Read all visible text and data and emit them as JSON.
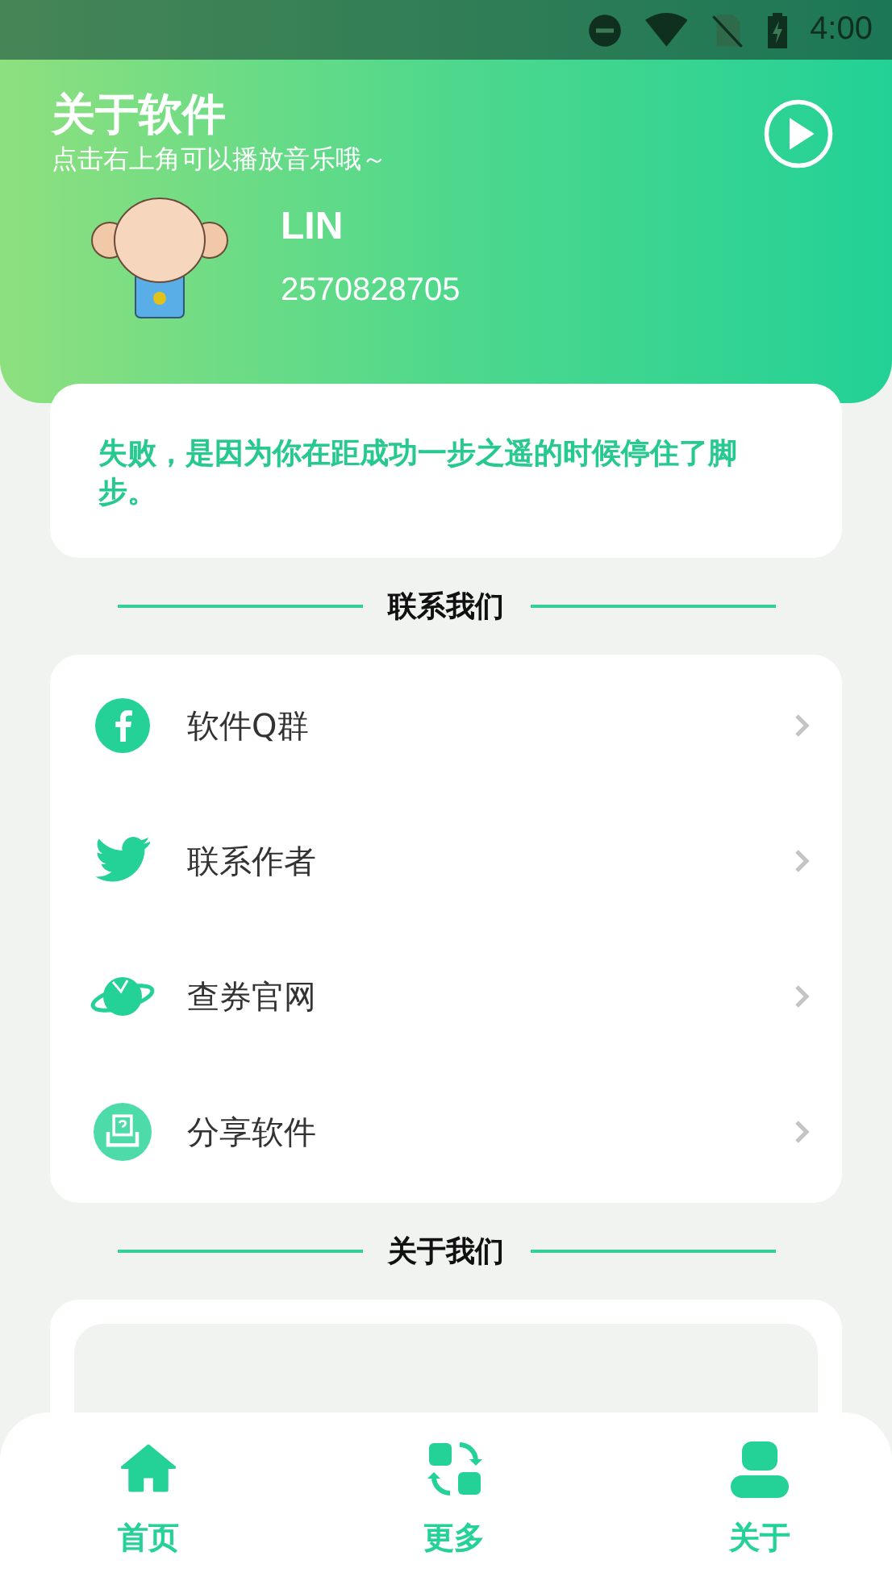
{
  "status_bar": {
    "time": "4:00"
  },
  "header": {
    "title": "关于软件",
    "subtitle": "点击右上角可以播放音乐哦～",
    "user": {
      "name": "LIN",
      "id": "2570828705"
    }
  },
  "quote": "失败，是因为你在距成功一步之遥的时候停住了脚步。",
  "contact": {
    "heading": "联系我们",
    "items": [
      {
        "kind": "facebook",
        "label": "软件Q群"
      },
      {
        "kind": "bird",
        "label": "联系作者"
      },
      {
        "kind": "planet",
        "label": "查券官网"
      },
      {
        "kind": "share",
        "label": "分享软件"
      }
    ]
  },
  "about": {
    "heading": "关于我们"
  },
  "nav": [
    {
      "kind": "home",
      "label": "首页"
    },
    {
      "kind": "more",
      "label": "更多"
    },
    {
      "kind": "person",
      "label": "关于"
    }
  ]
}
